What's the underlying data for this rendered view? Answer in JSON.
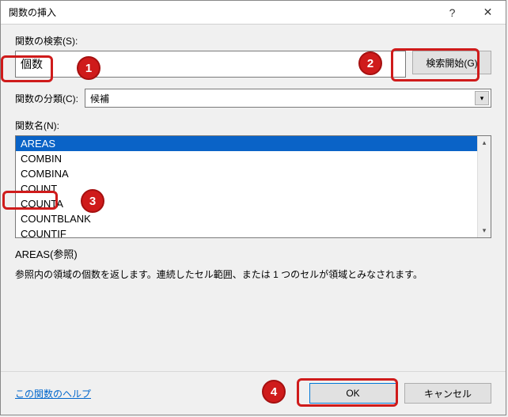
{
  "titlebar": {
    "title": "関数の挿入",
    "help_symbol": "?",
    "close_symbol": "✕"
  },
  "search": {
    "label": "関数の検索(S):",
    "value": "個数",
    "button_label": "検索開始(G)"
  },
  "category": {
    "label": "関数の分類(C):",
    "selected": "候補"
  },
  "funclist": {
    "label": "関数名(N):",
    "items": [
      {
        "name": "AREAS",
        "selected": true
      },
      {
        "name": "COMBIN",
        "selected": false
      },
      {
        "name": "COMBINA",
        "selected": false
      },
      {
        "name": "COUNT",
        "selected": false
      },
      {
        "name": "COUNTA",
        "selected": false
      },
      {
        "name": "COUNTBLANK",
        "selected": false
      },
      {
        "name": "COUNTIF",
        "selected": false
      }
    ]
  },
  "description": {
    "signature": "AREAS(参照)",
    "text": "参照内の領域の個数を返します。連続したセル範囲、または 1 つのセルが領域とみなされます。"
  },
  "footer": {
    "help_link": "この関数のヘルプ",
    "ok_label": "OK",
    "cancel_label": "キャンセル"
  },
  "annotations": {
    "b1": "1",
    "b2": "2",
    "b3": "3",
    "b4": "4"
  }
}
